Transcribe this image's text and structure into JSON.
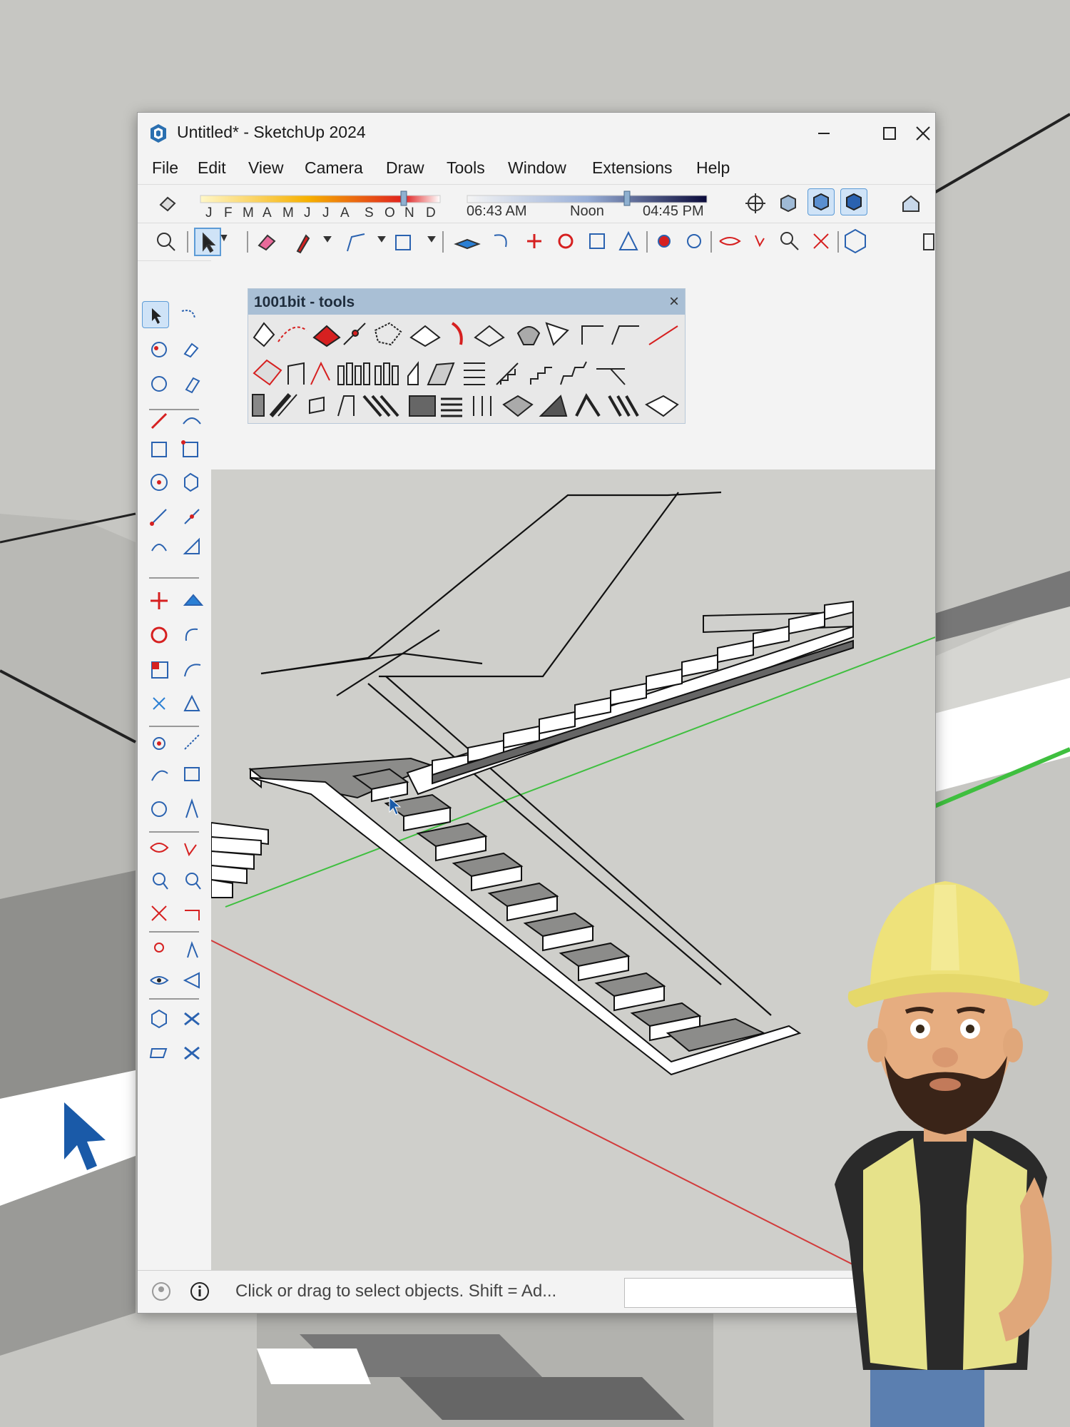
{
  "window": {
    "title": "Untitled* - SketchUp 2024"
  },
  "menu": [
    "File",
    "Edit",
    "View",
    "Camera",
    "Draw",
    "Tools",
    "Window",
    "Extensions",
    "Help"
  ],
  "shadows": {
    "months": [
      "J",
      "F",
      "M",
      "A",
      "M",
      "J",
      "J",
      "A",
      "S",
      "O",
      "N",
      "D"
    ],
    "time_start": "06:43 AM",
    "time_mid": "Noon",
    "time_end": "04:45 PM"
  },
  "extension_panel": {
    "title": "1001bit - tools",
    "close": "×"
  },
  "status": {
    "text": "Click or drag to select objects. Shift = Ad..."
  },
  "icons": {
    "app": "sketchup-logo-icon",
    "minimize": "minimize-icon",
    "maximize": "maximize-icon",
    "close": "close-icon",
    "select": "select-arrow-icon",
    "eraser": "eraser-icon",
    "pencil": "pencil-icon",
    "rectangle": "rectangle-icon",
    "circle": "circle-icon",
    "pushpull": "push-pull-icon",
    "move": "move-icon",
    "rotate": "rotate-icon",
    "scale": "scale-icon",
    "orbit": "orbit-icon",
    "pan": "pan-icon",
    "zoom": "zoom-icon",
    "tape": "tape-measure-icon",
    "text": "text-icon",
    "walk": "walk-icon",
    "geo": "geo-location-icon",
    "info": "info-icon",
    "character": "construction-worker-character"
  },
  "colors": {
    "axis_red": "#d23b3b",
    "axis_green": "#3fbf3f",
    "accent": "#2a7fd4"
  }
}
